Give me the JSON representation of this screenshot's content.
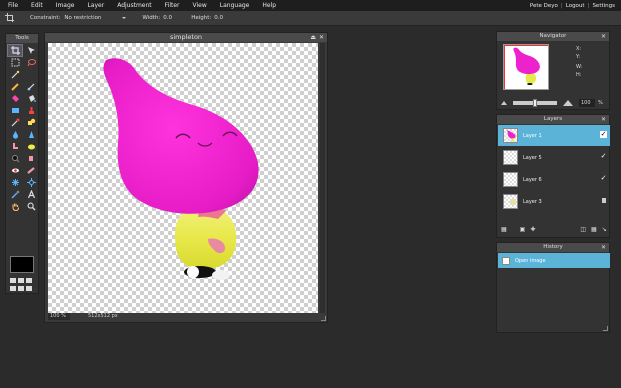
{
  "menu": [
    "File",
    "Edit",
    "Image",
    "Layer",
    "Adjustment",
    "Filter",
    "View",
    "Language",
    "Help"
  ],
  "user": {
    "name": "Pete Deyo",
    "logout": "Logout",
    "settings": "Settings",
    "sep": "|"
  },
  "options": {
    "constraint_label": "Constraint:",
    "constraint_value": "No restriction",
    "width_label": "Width:",
    "width_value": "0.0",
    "height_label": "Height:",
    "height_value": "0.0"
  },
  "tools_panel": {
    "title": "Tools"
  },
  "canvas": {
    "title": "simpleton",
    "zoom": "100 %",
    "dimensions": "512x512 px"
  },
  "navigator": {
    "title": "Navigator",
    "x_label": "X:",
    "y_label": "Y:",
    "w_label": "W:",
    "h_label": "H:",
    "zoom_value": "100",
    "zoom_unit": "%"
  },
  "layers": {
    "title": "Layers",
    "items": [
      {
        "name": "Layer 1",
        "selected": true,
        "visible": true
      },
      {
        "name": "Layer 5",
        "selected": false,
        "visible": true
      },
      {
        "name": "Layer 6",
        "selected": false,
        "visible": true
      },
      {
        "name": "Layer 3",
        "selected": false,
        "locked": true
      }
    ]
  },
  "history": {
    "title": "History",
    "items": [
      "Open image"
    ]
  },
  "colors": {
    "accent": "#5bb4d8",
    "magenta": "#ee22cc",
    "yellow": "#e8e84a"
  }
}
